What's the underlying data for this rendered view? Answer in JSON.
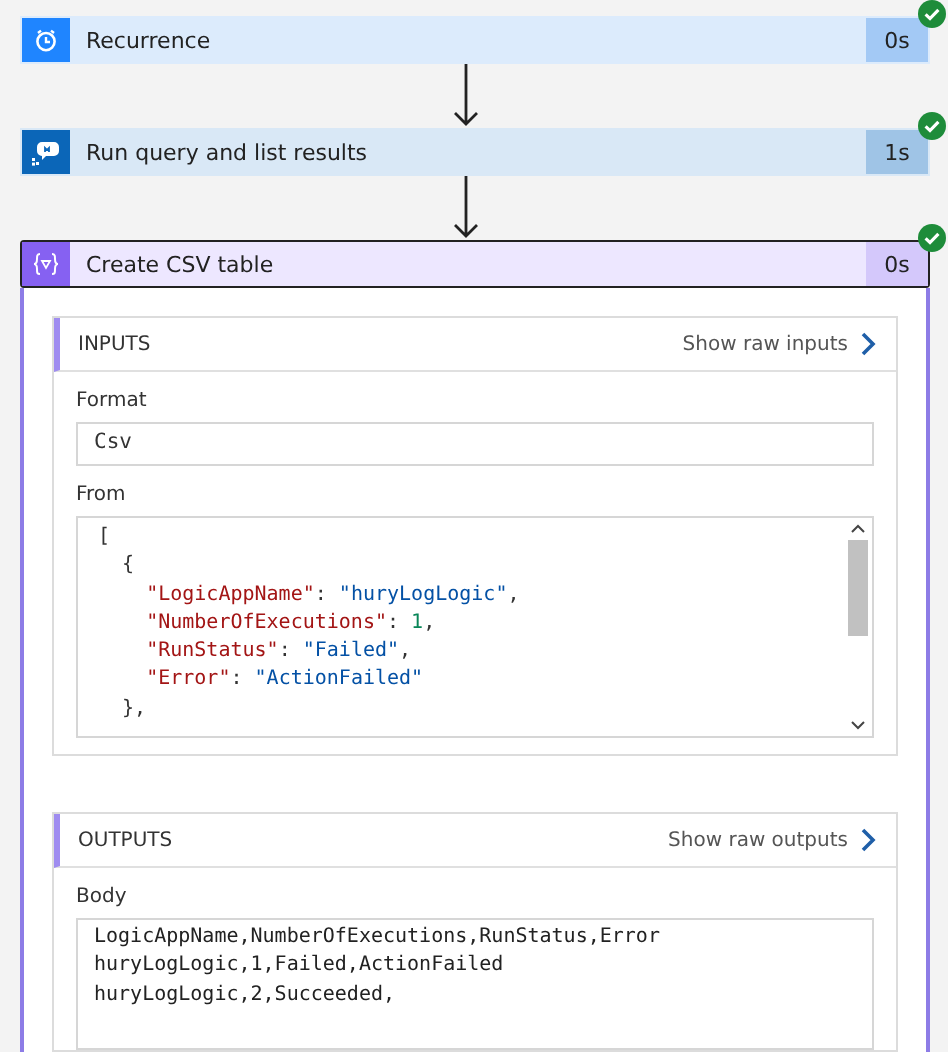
{
  "steps": [
    {
      "title": "Recurrence",
      "duration": "0s",
      "kind": "clock",
      "color": "#1f85ff",
      "succeeded": true,
      "selected": false
    },
    {
      "title": "Run query and list results",
      "duration": "1s",
      "kind": "query",
      "color": "#0b66b8",
      "succeeded": true,
      "selected": false
    },
    {
      "title": "Create CSV table",
      "duration": "0s",
      "kind": "expression",
      "color": "#8661f2",
      "succeeded": true,
      "selected": true
    }
  ],
  "inputs": {
    "heading": "INPUTS",
    "raw_link": "Show raw inputs",
    "format": {
      "label": "Format",
      "value": "Csv"
    },
    "from": {
      "label": "From",
      "lines": [
        [
          {
            "kind": "punct",
            "text": "["
          }
        ],
        [
          {
            "kind": "punct",
            "text": "  {"
          }
        ],
        [
          {
            "kind": "key",
            "text": "    \"LogicAppName\""
          },
          {
            "kind": "punct",
            "text": ": "
          },
          {
            "kind": "string",
            "text": "\"huryLogLogic\""
          },
          {
            "kind": "punct",
            "text": ","
          }
        ],
        [
          {
            "kind": "key",
            "text": "    \"NumberOfExecutions\""
          },
          {
            "kind": "punct",
            "text": ": "
          },
          {
            "kind": "number",
            "text": "1"
          },
          {
            "kind": "punct",
            "text": ","
          }
        ],
        [
          {
            "kind": "key",
            "text": "    \"RunStatus\""
          },
          {
            "kind": "punct",
            "text": ": "
          },
          {
            "kind": "string",
            "text": "\"Failed\""
          },
          {
            "kind": "punct",
            "text": ","
          }
        ],
        [
          {
            "kind": "key",
            "text": "    \"Error\""
          },
          {
            "kind": "punct",
            "text": ": "
          },
          {
            "kind": "string",
            "text": "\"ActionFailed\""
          }
        ],
        [
          {
            "kind": "punct",
            "text": "  },"
          }
        ]
      ]
    }
  },
  "outputs": {
    "heading": "OUTPUTS",
    "raw_link": "Show raw outputs",
    "body": {
      "label": "Body",
      "lines": [
        "LogicAppName,NumberOfExecutions,RunStatus,Error",
        "huryLogLogic,1,Failed,ActionFailed",
        "huryLogLogic,2,Succeeded,"
      ]
    }
  }
}
